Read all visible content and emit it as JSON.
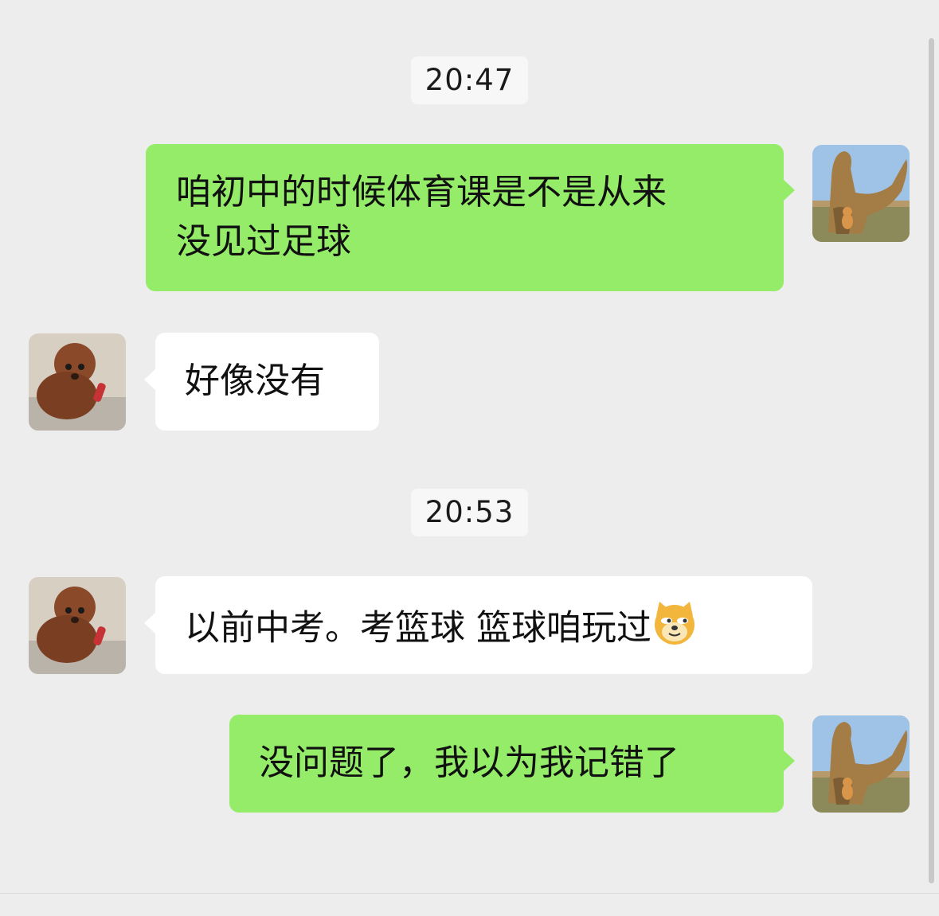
{
  "messages": [
    {
      "type": "time",
      "text": "20:47"
    },
    {
      "type": "bubble",
      "sender": "me",
      "text_line1": "咱初中的时候体育课是不是从来",
      "text_line2": "没见过足球"
    },
    {
      "type": "bubble",
      "sender": "them",
      "text": "好像没有"
    },
    {
      "type": "time",
      "text": "20:53"
    },
    {
      "type": "bubble",
      "sender": "them",
      "text": "以前中考。考篮球 篮球咱玩过",
      "emoji": "doge-emoji"
    },
    {
      "type": "bubble",
      "sender": "me",
      "text": "没问题了，我以为我记错了"
    }
  ],
  "avatars": {
    "me": "dinosaur-statue-with-shiba-dog-photo",
    "them": "brown-poodle-photo"
  },
  "colors": {
    "background": "#ededed",
    "my_bubble": "#95ec69",
    "their_bubble": "#ffffff"
  }
}
